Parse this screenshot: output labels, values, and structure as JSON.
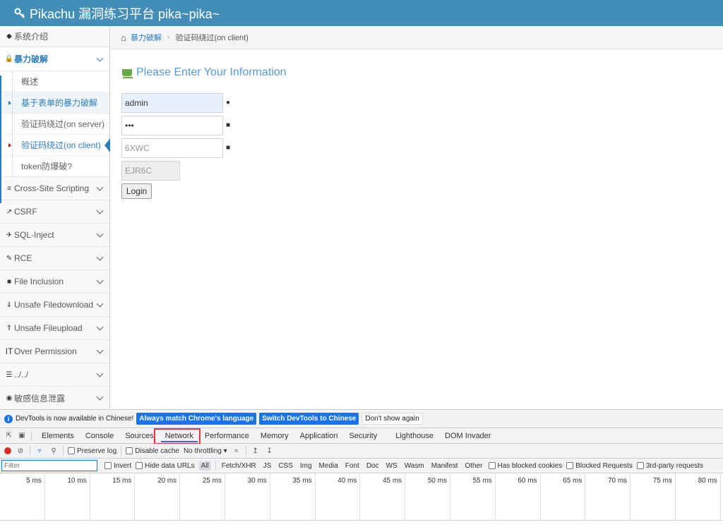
{
  "header": {
    "title": "Pikachu 漏洞练习平台 pika~pika~",
    "icon": "key-icon"
  },
  "sidebar": {
    "items": [
      {
        "label": "系统介绍",
        "icon": "tag-icon"
      },
      {
        "label": "暴力破解",
        "icon": "lock-icon",
        "open": true,
        "subs": [
          "概述",
          "基于表单的暴力破解",
          "验证码绕过(on server)",
          "验证码绕过(on client)",
          "token防爆破?"
        ]
      },
      {
        "label": "Cross-Site Scripting",
        "icon": "list-icon"
      },
      {
        "label": "CSRF",
        "icon": "share-icon"
      },
      {
        "label": "SQL-Inject",
        "icon": "plane-icon"
      },
      {
        "label": "RCE",
        "icon": "pencil-icon"
      },
      {
        "label": "File Inclusion",
        "icon": "file-icon"
      },
      {
        "label": "Unsafe Filedownload",
        "icon": "download-icon"
      },
      {
        "label": "Unsafe Fileupload",
        "icon": "upload-icon"
      },
      {
        "label": "Over Permission",
        "icon": "text-height-icon"
      },
      {
        "label": "../../",
        "icon": "align-icon"
      },
      {
        "label": "敏感信息泄露",
        "icon": "camera-icon"
      }
    ]
  },
  "breadcrumb": {
    "link": "暴力破解",
    "current": "验证码绕过(on client)"
  },
  "form": {
    "title": "Please Enter Your Information",
    "username": "admin",
    "password": "•••",
    "captcha_input": "6XWC",
    "captcha_code": "EJR6C",
    "login_label": "Login"
  },
  "devtools": {
    "info_text": "DevTools is now available in Chinese!",
    "btn_match": "Always match Chrome's language",
    "btn_switch": "Switch DevTools to Chinese",
    "btn_dont": "Don't show again",
    "tabs": [
      "Elements",
      "Console",
      "Sources",
      "Network",
      "Performance",
      "Memory",
      "Application",
      "Security",
      "Lighthouse",
      "DOM Invader"
    ],
    "selected_tab": "Network",
    "preserve_log": "Preserve log",
    "disable_cache": "Disable cache",
    "throttling": "No throttling",
    "filter_placeholder": "Filter",
    "invert": "Invert",
    "hide_data": "Hide data URLs",
    "types": [
      "All",
      "Fetch/XHR",
      "JS",
      "CSS",
      "Img",
      "Media",
      "Font",
      "Doc",
      "WS",
      "Wasm",
      "Manifest",
      "Other"
    ],
    "blocked_cookies": "Has blocked cookies",
    "blocked_requests": "Blocked Requests",
    "third_party": "3rd-party requests",
    "ticks": [
      "5 ms",
      "10 ms",
      "15 ms",
      "20 ms",
      "25 ms",
      "30 ms",
      "35 ms",
      "40 ms",
      "45 ms",
      "50 ms",
      "55 ms",
      "60 ms",
      "65 ms",
      "70 ms",
      "75 ms",
      "80 ms"
    ]
  },
  "colors": {
    "header": "#438eb9",
    "accent": "#2b7dbc",
    "devtools_blue": "#1a73e8",
    "highlight_red": "#e53935"
  }
}
